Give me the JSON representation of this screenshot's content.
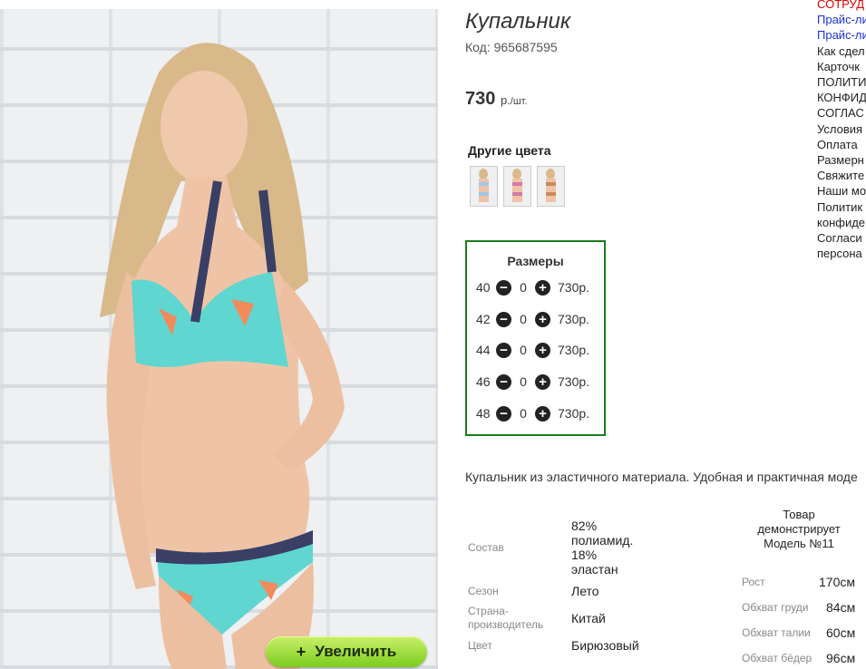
{
  "product": {
    "title": "Купальник",
    "code": "Код: 965687595",
    "price_value": "730",
    "price_unit": "р.",
    "price_per": "/шт."
  },
  "gallery": {
    "zoom_label": "Увеличить",
    "zoom_icon": "plus"
  },
  "other_colors": {
    "heading": "Другие цвета",
    "thumbs": [
      "thumb-1",
      "thumb-2",
      "thumb-3"
    ]
  },
  "sizes": {
    "heading": "Размеры",
    "rows": [
      {
        "size": "40",
        "qty": "0",
        "price": "730р."
      },
      {
        "size": "42",
        "qty": "0",
        "price": "730р."
      },
      {
        "size": "44",
        "qty": "0",
        "price": "730р."
      },
      {
        "size": "46",
        "qty": "0",
        "price": "730р."
      },
      {
        "size": "48",
        "qty": "0",
        "price": "730р."
      }
    ],
    "border_color": "#1a7d1a"
  },
  "description": "Купальник из эластичного материала. Удобная и практичная моде",
  "properties": [
    {
      "label": "Состав",
      "value": "82% полиамид. 18% эластан"
    },
    {
      "label": "Сезон",
      "value": "Лето"
    },
    {
      "label": "Страна-производитель",
      "value": "Китай"
    },
    {
      "label": "Цвет",
      "value": "Бирюзовый"
    }
  ],
  "model": {
    "heading": "Товар демонстрирует Модель №11",
    "measures": [
      {
        "label": "Рост",
        "value": "170см"
      },
      {
        "label": "Обхват груди",
        "value": "84см"
      },
      {
        "label": "Обхват талии",
        "value": "60см"
      },
      {
        "label": "Обхват бёдер",
        "value": "96см"
      }
    ]
  },
  "right_links": [
    "СОТРУД",
    "Прайс-ли",
    "Прайс-ли",
    "Как сдел",
    "Карточк",
    "ПОЛИТИ",
    "КОНФИД",
    "СОГЛАС",
    "Условия",
    "Оплата",
    "Размерн",
    "Свяжите",
    "Наши мо",
    "Политик",
    "конфиде",
    "Согласи",
    "персона"
  ]
}
